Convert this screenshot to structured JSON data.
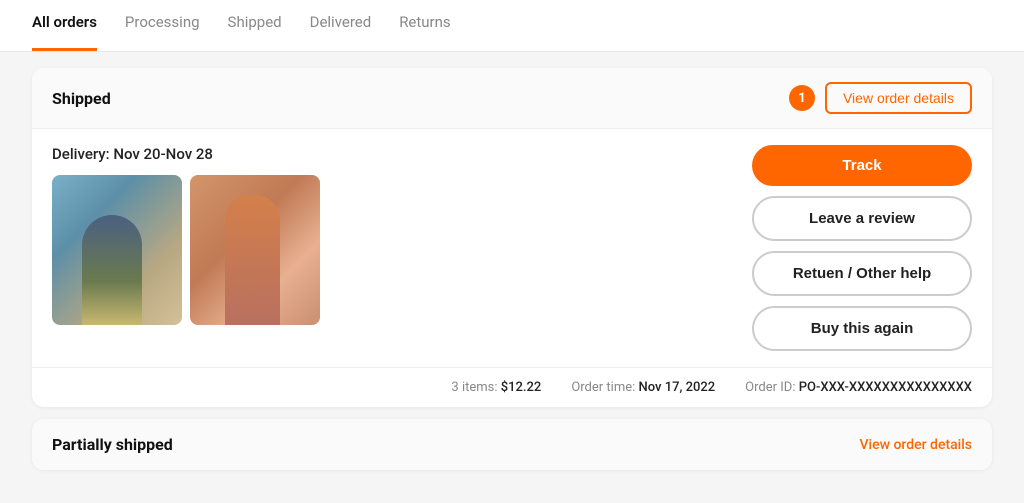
{
  "tabs": [
    {
      "id": "all-orders",
      "label": "All orders",
      "active": true
    },
    {
      "id": "processing",
      "label": "Processing",
      "active": false
    },
    {
      "id": "shipped",
      "label": "Shipped",
      "active": false
    },
    {
      "id": "delivered",
      "label": "Delivered",
      "active": false
    },
    {
      "id": "returns",
      "label": "Returns",
      "active": false
    }
  ],
  "order_card": {
    "status": "Shipped",
    "badge_count": "1",
    "view_details_label": "View order details",
    "delivery_text": "Delivery: Nov 20-Nov 28",
    "track_label": "Track",
    "leave_review_label": "Leave a review",
    "other_help_label": "Retuen / Other help",
    "buy_again_label": "Buy this again",
    "footer": {
      "items_label": "3 items:",
      "items_price": "$12.22",
      "order_time_label": "Order time:",
      "order_time_value": "Nov 17, 2022",
      "order_id_label": "Order ID:",
      "order_id_value": "PO-XXX-XXXXXXXXXXXXXXX"
    }
  },
  "partial_card": {
    "status": "Partially shipped",
    "view_details_label": "View order details"
  },
  "colors": {
    "accent": "#f60",
    "tab_active_border": "#f60"
  }
}
